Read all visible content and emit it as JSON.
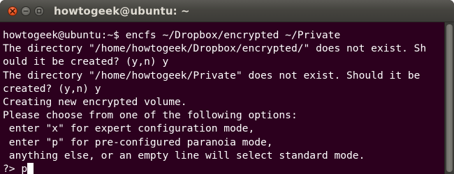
{
  "window": {
    "title": "howtogeek@ubuntu: ~"
  },
  "colors": {
    "terminal_bg": "#2c001e",
    "terminal_text": "#ffffff",
    "titlebar": "#3c3b37",
    "close_button": "#e9541f"
  },
  "icons": {
    "close": "close-icon",
    "minimize": "minimize-icon",
    "maximize": "maximize-icon"
  },
  "terminal": {
    "lines": [
      "howtogeek@ubuntu:~$ encfs ~/Dropbox/encrypted ~/Private",
      "The directory \"/home/howtogeek/Dropbox/encrypted/\" does not exist. Sh",
      "ould it be created? (y,n) y",
      "The directory \"/home/howtogeek/Private\" does not exist. Should it be",
      "created? (y,n) y",
      "Creating new encrypted volume.",
      "Please choose from one of the following options:",
      " enter \"x\" for expert configuration mode,",
      " enter \"p\" for pre-configured paranoia mode,",
      " anything else, or an empty line will select standard mode."
    ],
    "prompt": "?> ",
    "input": "p"
  }
}
